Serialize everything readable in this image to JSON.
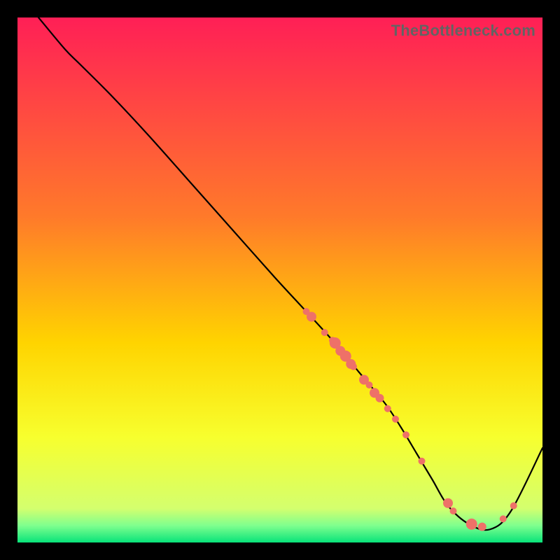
{
  "watermark": "TheBottleneck.com",
  "chart_data": {
    "type": "line",
    "title": "",
    "xlabel": "",
    "ylabel": "",
    "xlim": [
      0,
      100
    ],
    "ylim": [
      0,
      100
    ],
    "grid": false,
    "legend": false,
    "gradient_stops": [
      {
        "offset": 0,
        "color": "#ff1f56"
      },
      {
        "offset": 0.38,
        "color": "#ff7a2a"
      },
      {
        "offset": 0.62,
        "color": "#ffd400"
      },
      {
        "offset": 0.8,
        "color": "#f7ff2e"
      },
      {
        "offset": 0.935,
        "color": "#d4ff6e"
      },
      {
        "offset": 0.968,
        "color": "#7eff8e"
      },
      {
        "offset": 1.0,
        "color": "#08e37a"
      }
    ],
    "series": [
      {
        "name": "bottleneck-curve",
        "x": [
          4,
          9,
          12,
          18,
          25,
          33,
          41,
          49,
          55,
          60,
          65,
          70,
          73,
          76,
          79,
          82,
          86,
          90,
          94,
          100
        ],
        "y": [
          100,
          94,
          91,
          85,
          77.5,
          68.5,
          59.5,
          50.5,
          44,
          38.5,
          32.5,
          26.5,
          22,
          17,
          12,
          7,
          3.5,
          2.5,
          6,
          18
        ]
      }
    ],
    "points": {
      "name": "marker-dots",
      "color": "#ee7168",
      "items": [
        {
          "x": 55.0,
          "y": 44.0,
          "r": 5
        },
        {
          "x": 56.0,
          "y": 43.0,
          "r": 7
        },
        {
          "x": 58.5,
          "y": 40.0,
          "r": 5
        },
        {
          "x": 60.0,
          "y": 38.5,
          "r": 5
        },
        {
          "x": 60.5,
          "y": 38.0,
          "r": 8
        },
        {
          "x": 61.5,
          "y": 36.5,
          "r": 7
        },
        {
          "x": 62.5,
          "y": 35.5,
          "r": 8
        },
        {
          "x": 63.5,
          "y": 34.0,
          "r": 7
        },
        {
          "x": 64.0,
          "y": 33.5,
          "r": 5
        },
        {
          "x": 66.0,
          "y": 31.0,
          "r": 7
        },
        {
          "x": 67.0,
          "y": 30.0,
          "r": 5
        },
        {
          "x": 68.0,
          "y": 28.5,
          "r": 7
        },
        {
          "x": 69.0,
          "y": 27.5,
          "r": 6
        },
        {
          "x": 70.5,
          "y": 25.5,
          "r": 5
        },
        {
          "x": 72.0,
          "y": 23.5,
          "r": 5
        },
        {
          "x": 74.0,
          "y": 20.5,
          "r": 5
        },
        {
          "x": 77.0,
          "y": 15.5,
          "r": 5
        },
        {
          "x": 82.0,
          "y": 7.5,
          "r": 7
        },
        {
          "x": 83.0,
          "y": 6.0,
          "r": 5
        },
        {
          "x": 86.5,
          "y": 3.5,
          "r": 8
        },
        {
          "x": 88.5,
          "y": 3.0,
          "r": 6
        },
        {
          "x": 92.5,
          "y": 4.5,
          "r": 5
        },
        {
          "x": 94.5,
          "y": 7.0,
          "r": 5
        }
      ]
    }
  }
}
